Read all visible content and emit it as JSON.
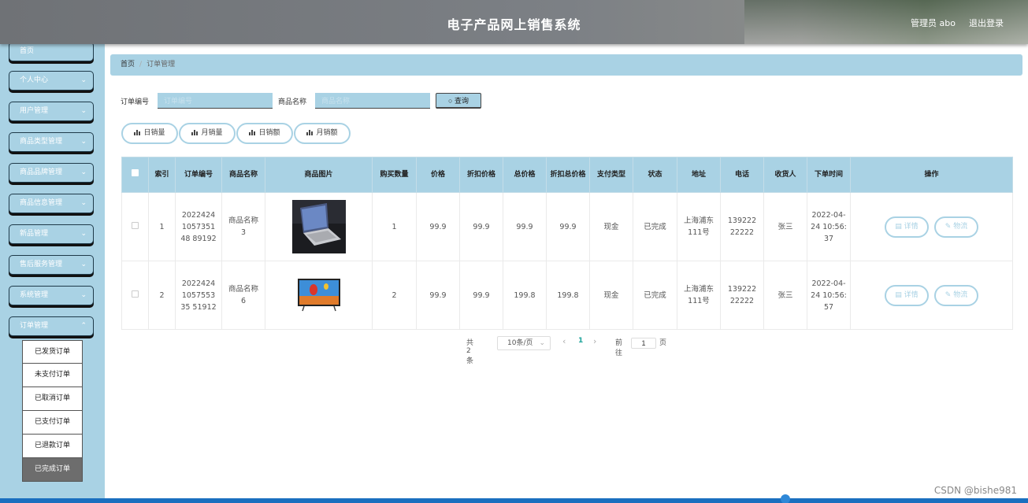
{
  "header": {
    "title": "电子产品网上销售系统",
    "user": "管理员 abo",
    "logout": "退出登录"
  },
  "sidebar": {
    "top_item": "首页",
    "items": [
      "个人中心",
      "用户管理",
      "商品类型管理",
      "商品品牌管理",
      "商品信息管理",
      "新品管理",
      "售后服务管理",
      "系统管理",
      "订单管理"
    ],
    "submenu": [
      "已发货订单",
      "未支付订单",
      "已取消订单",
      "已支付订单",
      "已退款订单",
      "已完成订单"
    ],
    "active_submenu": "已完成订单"
  },
  "breadcrumb": {
    "home": "首页",
    "separator": "/",
    "current": "订单管理"
  },
  "search": {
    "order_no_label": "订单编号",
    "order_no_placeholder": "订单编号",
    "product_name_label": "商品名称",
    "product_name_placeholder": "商品名称",
    "query_label": "查询"
  },
  "stats": [
    "日销量",
    "月销量",
    "日销额",
    "月销额"
  ],
  "table": {
    "headers": [
      "",
      "索引",
      "订单编号",
      "商品名称",
      "商品图片",
      "购买数量",
      "价格",
      "折扣价格",
      "总价格",
      "折扣总价格",
      "支付类型",
      "状态",
      "地址",
      "电话",
      "收货人",
      "下单时间",
      "操作"
    ],
    "rows": [
      {
        "index": "1",
        "order_no": "2022424105735148 89192",
        "product": "商品名称3",
        "image": "laptop",
        "qty": "1",
        "price": "99.9",
        "discount_price": "99.9",
        "total": "99.9",
        "discount_total": "99.9",
        "pay_type": "现金",
        "status": "已完成",
        "address": "上海浦东111号",
        "phone": "13922222222",
        "receiver": "张三",
        "time": "2022-04-24 10:56:37"
      },
      {
        "index": "2",
        "order_no": "2022424105755335 51912",
        "product": "商品名称6",
        "image": "tv",
        "qty": "2",
        "price": "99.9",
        "discount_price": "99.9",
        "total": "199.8",
        "discount_total": "199.8",
        "pay_type": "现金",
        "status": "已完成",
        "address": "上海浦东111号",
        "phone": "13922222222",
        "receiver": "张三",
        "time": "2022-04-24 10:56:57"
      }
    ],
    "detail_label": "详情",
    "logistics_label": "物流"
  },
  "pagination": {
    "total": "共 2 条",
    "page_size": "10条/页",
    "prev": "‹",
    "current_page": "1",
    "next": "›",
    "goto_label": "前往",
    "goto_value": "1",
    "page_unit": "页"
  },
  "watermark": "CSDN @bishe981",
  "colors": {
    "accent": "#a9d2e4",
    "header": "#7c8085",
    "active_page": "#1ca39a"
  }
}
